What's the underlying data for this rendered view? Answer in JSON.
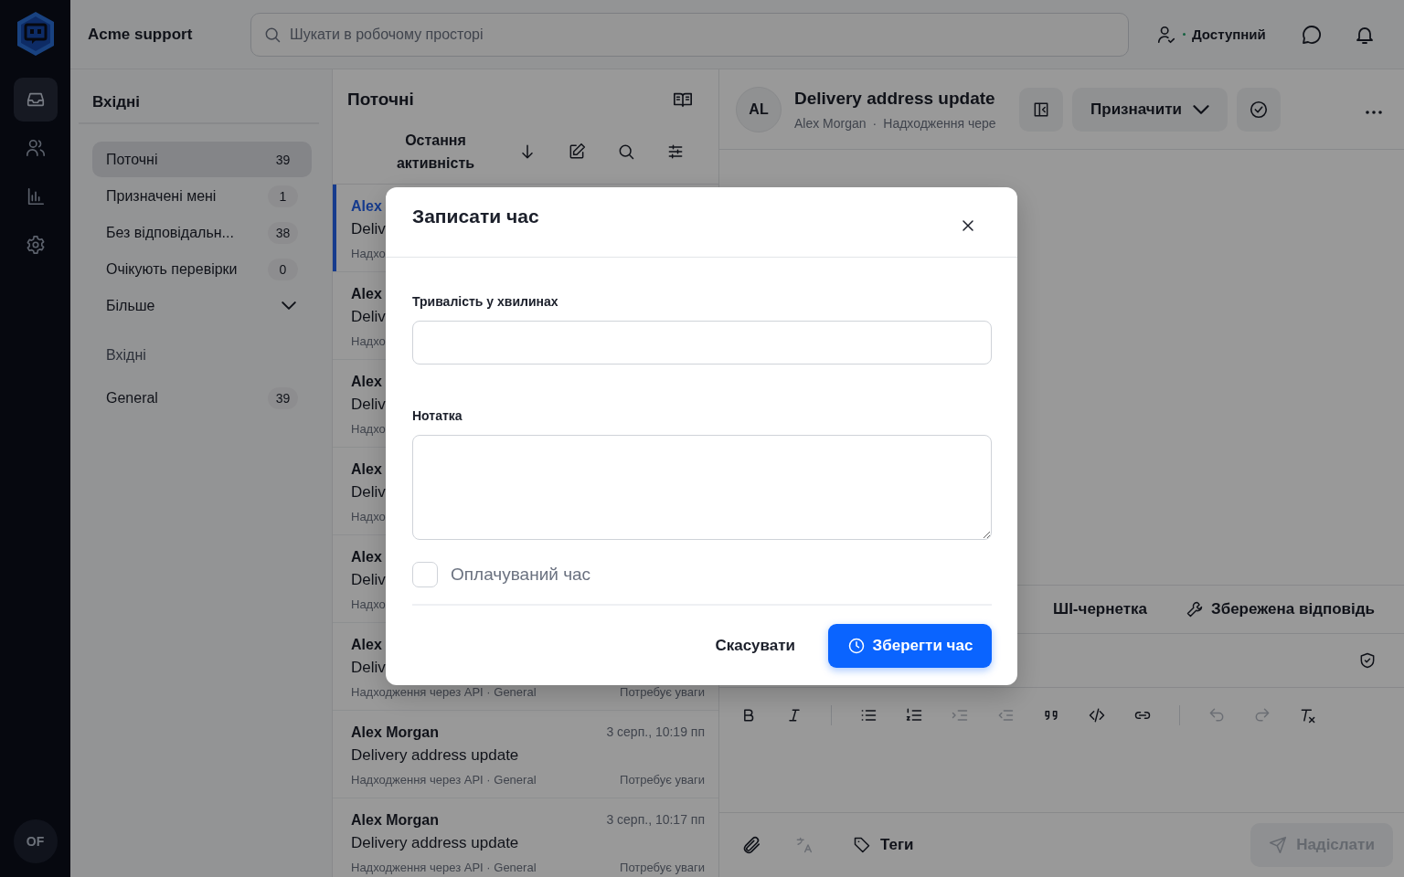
{
  "rail": {
    "avatar": "OF",
    "items": [
      {
        "kind": "inbox",
        "selected": true
      },
      {
        "kind": "contacts",
        "selected": false
      },
      {
        "kind": "reports",
        "selected": false
      },
      {
        "kind": "settings",
        "selected": false
      }
    ]
  },
  "topbar": {
    "workspace": "Acme support",
    "search": {
      "placeholder": "Шукати в робочому просторі"
    },
    "status": "Доступний"
  },
  "sidebar": {
    "title": "Вхідні",
    "views": [
      {
        "label": "Поточні",
        "count": "39",
        "selected": true
      },
      {
        "label": "Призначені мені",
        "count": "1",
        "selected": false
      },
      {
        "label": "Без відповідальн...",
        "count": "38",
        "selected": false
      },
      {
        "label": "Очікують перевірки",
        "count": "0",
        "selected": false
      }
    ],
    "more": {
      "label": "Більше",
      "expanded": false
    },
    "section": "Вхідні",
    "inboxes": [
      {
        "label": "General",
        "count": "39",
        "selected": false
      }
    ]
  },
  "list": {
    "title": "Поточні",
    "sort": "Остання активність",
    "conversations": [
      {
        "name": "Alex",
        "subject": "Deliv",
        "meta": "Надхо",
        "selected": true
      },
      {
        "name": "Alex",
        "subject": "Deliv",
        "meta": "Надхо",
        "selected": false
      },
      {
        "name": "Alex",
        "subject": "Deliv",
        "meta": "Надхо",
        "selected": false
      },
      {
        "name": "Alex",
        "subject": "Deliv",
        "meta": "Надхо",
        "selected": false
      },
      {
        "name": "Alex",
        "subject": "Deliv",
        "meta": "Надхо",
        "selected": false
      },
      {
        "name": "Alex",
        "subject": "Deliv",
        "meta": "Надходження через API · General",
        "status": "Потребує уваги",
        "selected": false
      },
      {
        "name": "Alex Morgan",
        "time": "3 серп., 10:19 пп",
        "subject": "Delivery address update",
        "meta": "Надходження через API · General",
        "status": "Потребує уваги",
        "selected": false
      },
      {
        "name": "Alex Morgan",
        "time": "3 серп., 10:17 пп",
        "subject": "Delivery address update",
        "meta": "Надходження через API · General",
        "status": "Потребує уваги",
        "selected": false
      }
    ]
  },
  "detail": {
    "avatar": "AL",
    "title": "Delivery address update",
    "contact": "Alex Morgan",
    "separator": "·",
    "source": "Надходження чере",
    "assign": "Призначити",
    "composer": {
      "tabs": [
        {
          "label": "ШІ-чернетка",
          "kind": "ai"
        },
        {
          "label": "Збережена відповідь",
          "kind": "saved"
        }
      ],
      "toolbar": [
        {
          "kind": "bold",
          "disabled": false
        },
        {
          "kind": "italic",
          "disabled": false
        },
        {
          "kind": "separator"
        },
        {
          "kind": "bullet",
          "disabled": false
        },
        {
          "kind": "ordered",
          "disabled": false
        },
        {
          "kind": "indent",
          "disabled": true
        },
        {
          "kind": "outdent",
          "disabled": true
        },
        {
          "kind": "quote",
          "disabled": false
        },
        {
          "kind": "code",
          "disabled": false
        },
        {
          "kind": "link",
          "disabled": false
        },
        {
          "kind": "separator"
        },
        {
          "kind": "undo",
          "disabled": true
        },
        {
          "kind": "redo",
          "disabled": true
        },
        {
          "kind": "clear",
          "disabled": false
        }
      ],
      "translate": {
        "disabled": true
      },
      "tags": "Теги",
      "send": {
        "label": "Надіслати",
        "disabled": true
      }
    }
  },
  "modal": {
    "title": "Записати час",
    "fields": [
      {
        "label": "Тривалість у хвилинах",
        "kind": "input"
      },
      {
        "label": "Нотатка",
        "kind": "textarea"
      }
    ],
    "billable": {
      "label": "Оплачуваний час",
      "checked": false
    },
    "cancel": "Скасувати",
    "save": "Зберегти час"
  }
}
